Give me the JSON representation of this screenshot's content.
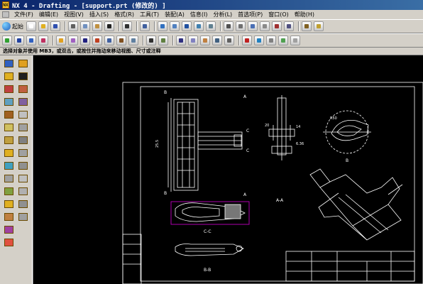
{
  "window": {
    "title": "NX 4 - Drafting - [support.prt  (修改的) ]"
  },
  "menu": {
    "items": [
      "文件(F)",
      "编辑(E)",
      "视图(V)",
      "插入(S)",
      "格式(R)",
      "工具(T)",
      "装配(A)",
      "信息(I)",
      "分析(L)",
      "首选项(P)",
      "窗口(O)",
      "帮助(H)"
    ]
  },
  "toolbar": {
    "start_label": "起始"
  },
  "status": {
    "prompt": "选择对象并使用 MB3，或双击，或按住并拖动来移动视图、尺寸或注释"
  },
  "drawing": {
    "section_labels": [
      "A",
      "A",
      "C",
      "C",
      "B",
      "B"
    ],
    "view_captions": [
      "A-A",
      "B",
      "C-C",
      "B-B"
    ],
    "dimension_texts": [
      "R50",
      "20",
      "14",
      "6.36",
      "25.5"
    ]
  },
  "colors": {
    "titlebar_start": "#0a246a",
    "titlebar_end": "#3a6ea5",
    "canvas": "#000000",
    "drawing_line": "#ffffff",
    "highlight": "#c000c0"
  }
}
